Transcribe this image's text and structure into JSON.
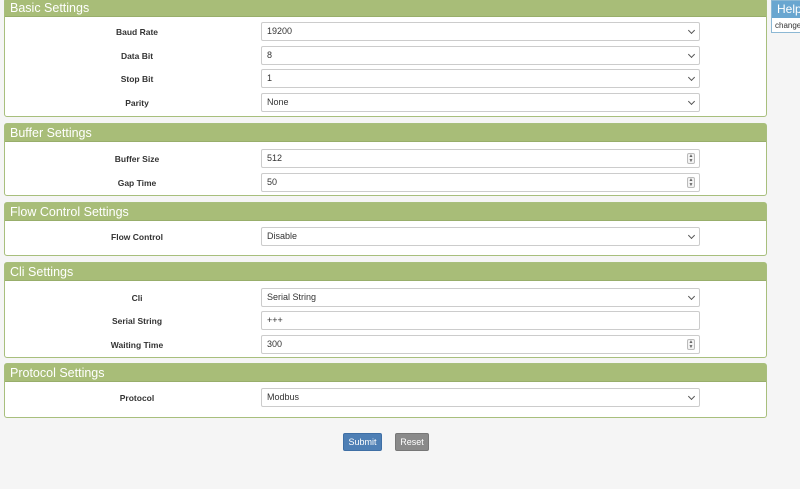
{
  "basic": {
    "title": "Basic Settings",
    "baud_rate_label": "Baud Rate",
    "baud_rate_value": "19200",
    "data_bit_label": "Data Bit",
    "data_bit_value": "8",
    "stop_bit_label": "Stop Bit",
    "stop_bit_value": "1",
    "parity_label": "Parity",
    "parity_value": "None"
  },
  "buffer": {
    "title": "Buffer Settings",
    "buffer_size_label": "Buffer Size",
    "buffer_size_value": "512",
    "gap_time_label": "Gap Time",
    "gap_time_value": "50"
  },
  "flow": {
    "title": "Flow Control Settings",
    "flow_control_label": "Flow Control",
    "flow_control_value": "Disable"
  },
  "cli": {
    "title": "Cli Settings",
    "cli_label": "Cli",
    "cli_value": "Serial String",
    "serial_string_label": "Serial String",
    "serial_string_value": "+++",
    "waiting_time_label": "Waiting Time",
    "waiting_time_value": "300"
  },
  "protocol": {
    "title": "Protocol Settings",
    "protocol_label": "Protocol",
    "protocol_value": "Modbus"
  },
  "actions": {
    "submit_label": "Submit",
    "reset_label": "Reset"
  },
  "help": {
    "title": "Help",
    "text": "change"
  },
  "icons": {
    "select_arrow": "chevron-down-icon",
    "number_spinner": "spinner-icon"
  },
  "colors": {
    "panel_header": "#a8bd78",
    "help_header": "#69a6d0",
    "submit": "#4e7fb5",
    "reset": "#8a8a8a"
  }
}
